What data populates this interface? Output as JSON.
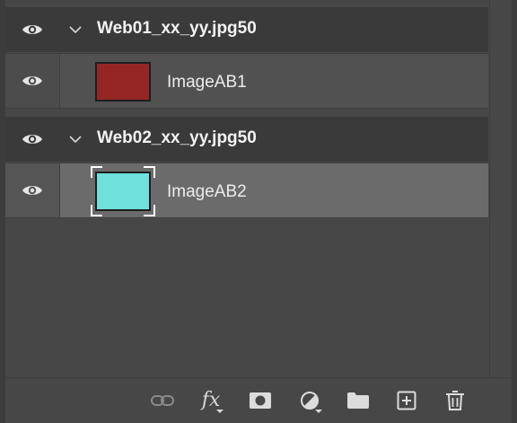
{
  "layers_panel": {
    "groups": [
      {
        "name": "Web01_xx_yy.jpg50",
        "layers": [
          {
            "name": "ImageAB1",
            "thumb_color": "#962626",
            "selected": false
          }
        ]
      },
      {
        "name": "Web02_xx_yy.jpg50",
        "layers": [
          {
            "name": "ImageAB2",
            "thumb_color": "#6fe0dc",
            "selected": true
          }
        ]
      }
    ]
  },
  "footer_tools": [
    {
      "icon": "link-icon"
    },
    {
      "icon": "fx-icon",
      "label": "fx"
    },
    {
      "icon": "layer-mask-icon"
    },
    {
      "icon": "adjustment-layer-icon"
    },
    {
      "icon": "folder-icon"
    },
    {
      "icon": "new-layer-icon"
    },
    {
      "icon": "trash-icon"
    }
  ],
  "colors": {
    "panel_bg": "#474747",
    "group_row_bg": "#3a3a3a",
    "layer_row_bg": "#515151",
    "selected_row_bg": "#6b6b6b",
    "text": "#f2f2f2"
  }
}
